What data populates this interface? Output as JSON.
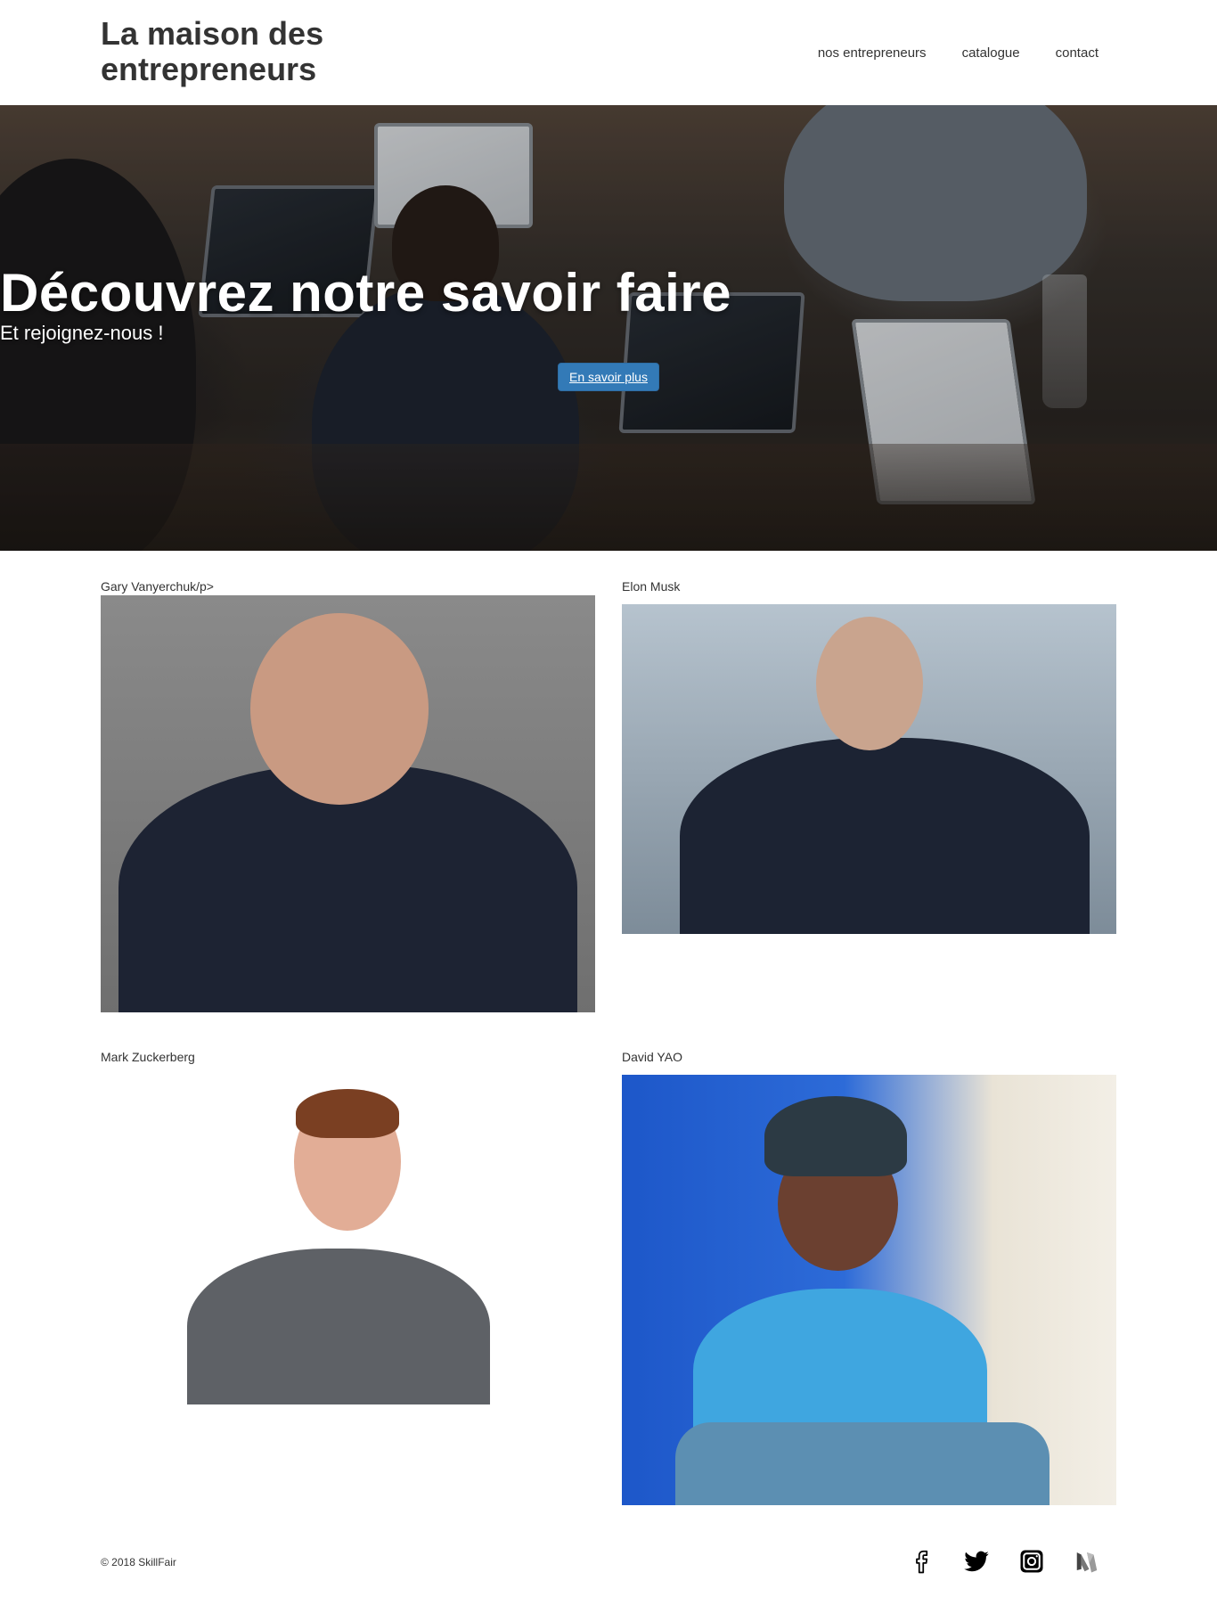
{
  "header": {
    "brand": "La maison des entrepreneurs",
    "nav": [
      "nos entrepreneurs",
      "catalogue",
      "contact"
    ]
  },
  "hero": {
    "title": "Découvrez notre savoir faire",
    "subtitle": "Et rejoignez-nous !",
    "button_label": "En savoir plus"
  },
  "entrepreneurs": [
    {
      "name": "Gary Vanyerchuk/p>"
    },
    {
      "name": "Elon Musk"
    },
    {
      "name": "Mark Zuckerberg"
    },
    {
      "name": "David YAO"
    }
  ],
  "footer": {
    "copyright": "© 2018 SkillFair",
    "social_icons": [
      "facebook-icon",
      "twitter-icon",
      "instagram-icon",
      "medium-icon"
    ]
  },
  "colors": {
    "primary_button": "#337ab7",
    "text": "#333333"
  }
}
